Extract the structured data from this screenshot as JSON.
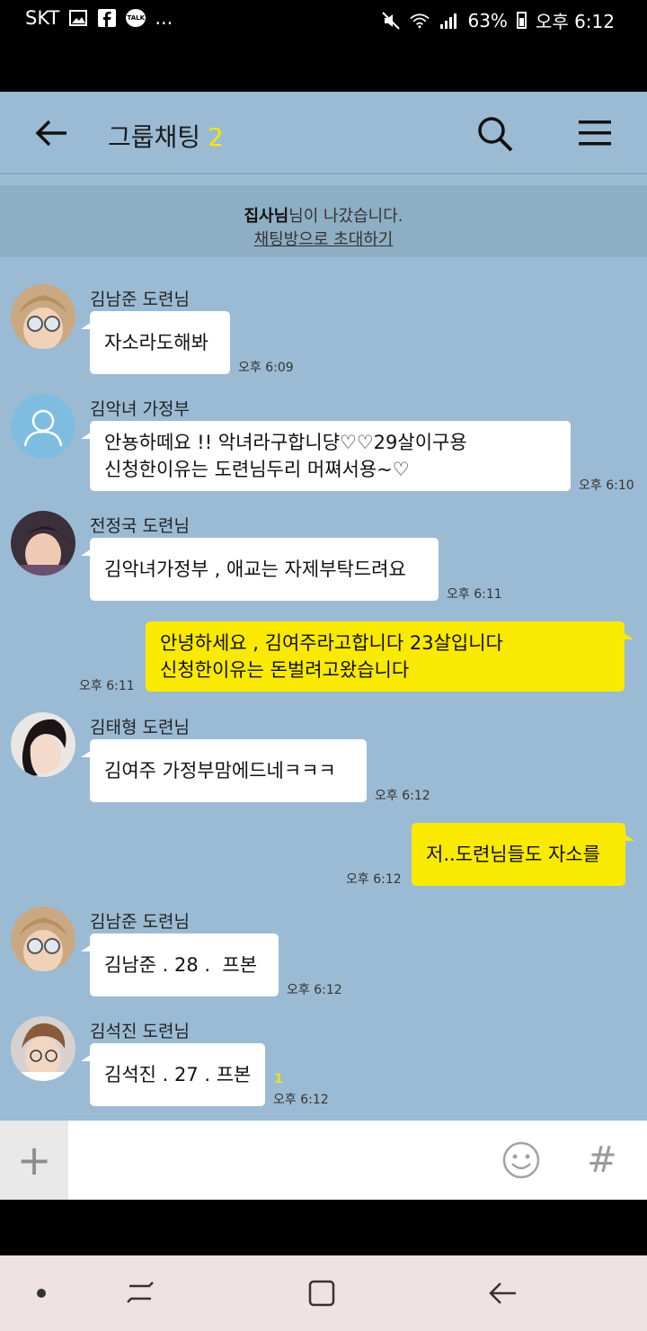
{
  "status_bar": {
    "carrier": "SKT",
    "left_icons": [
      "gallery-icon",
      "facebook-icon",
      "kakaotalk-icon"
    ],
    "talk_badge": "TALK",
    "more": "...",
    "battery_percent": "63%",
    "time": "오후 6:12"
  },
  "header": {
    "title": "그룹채팅",
    "member_count": "2"
  },
  "notice": {
    "name": "집사님",
    "text": "님이 나갔습니다.",
    "invite_link": "채팅방으로 초대하기"
  },
  "messages": [
    {
      "sender": "김남준 도련님",
      "text": "자소라도해봐",
      "time": "오후 6:09"
    },
    {
      "sender": "김악녀 가정부",
      "line1": "안뇽하떼요 !! 악녀라구합니댱♡♡29살이구용",
      "line2": "신청한이유는 도련님두리 머쪄서용~♡",
      "time": "오후 6:10"
    },
    {
      "sender": "전정국 도련님",
      "text": "김악녀가정부 , 애교는 자제부탁드려요",
      "time": "오후 6:11"
    },
    {
      "line1": "안녕하세요 , 김여주라고합니다 23살입니다",
      "line2": "신청한이유는 돈벌려고왔습니다",
      "time": "오후 6:11"
    },
    {
      "sender": "김태형 도련님",
      "text": "김여주 가정부맘에드네ㅋㅋㅋ",
      "time": "오후 6:12"
    },
    {
      "text": "저..도련님들도 자소를",
      "time": "오후 6:12"
    },
    {
      "sender": "김남준 도련님",
      "text": "김남준 . 28 .  프본",
      "time": "오후 6:12"
    },
    {
      "sender": "김석진 도련님",
      "text": "김석진 . 27 . 프본",
      "time": "오후 6:12",
      "unread": "1"
    }
  ],
  "input": {
    "plus": "+",
    "hash": "#"
  },
  "colors": {
    "chat_background": "#9bbbd4",
    "my_bubble": "#fae900",
    "other_bubble": "#ffffff",
    "accent_count": "#f7e600"
  }
}
